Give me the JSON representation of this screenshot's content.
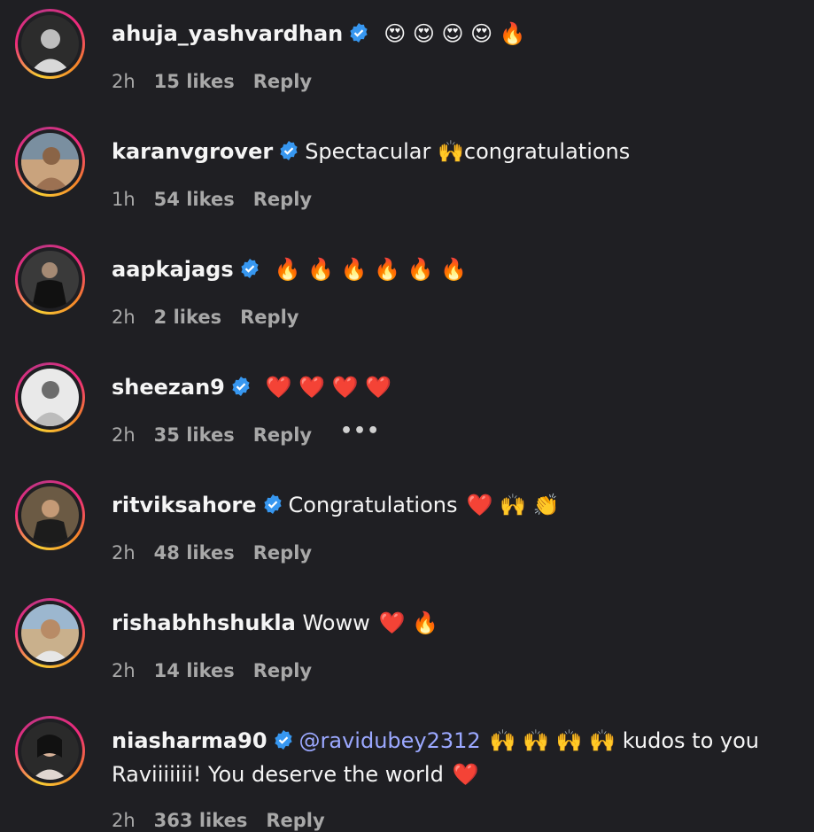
{
  "comments": [
    {
      "username": "ahuja_yashvardhan",
      "verified": true,
      "text": "",
      "emojis": "😍 😍 😍 😍 🔥",
      "time": "2h",
      "likes": "15 likes",
      "reply": "Reply"
    },
    {
      "username": "karanvgrover",
      "verified": true,
      "text": "Spectacular 🙌congratulations",
      "emojis": "",
      "time": "1h",
      "likes": "54 likes",
      "reply": "Reply"
    },
    {
      "username": "aapkajags",
      "verified": true,
      "text": "",
      "emojis": "🔥 🔥 🔥 🔥 🔥 🔥",
      "time": "2h",
      "likes": "2 likes",
      "reply": "Reply"
    },
    {
      "username": "sheezan9",
      "verified": true,
      "text": "",
      "emojis": "❤️ ❤️ ❤️ ❤️",
      "time": "2h",
      "likes": "35 likes",
      "reply": "Reply",
      "more": "•••"
    },
    {
      "username": "ritviksahore",
      "verified": true,
      "text": "Congratulations",
      "emojis": "❤️ 🙌 👏",
      "time": "2h",
      "likes": "48 likes",
      "reply": "Reply"
    },
    {
      "username": "rishabhhshukla",
      "verified": false,
      "text": "Woww",
      "emojis": "❤️ 🔥",
      "time": "2h",
      "likes": "14 likes",
      "reply": "Reply"
    },
    {
      "username": "niasharma90",
      "verified": true,
      "mention": "@ravidubey2312",
      "emojis": "🙌 🙌 🙌 🙌",
      "text": "kudos to you",
      "text_line2": "Raviiiiiii! You deserve the world",
      "emojis_line2": "❤️",
      "time": "2h",
      "likes": "363 likes",
      "reply": "Reply"
    }
  ],
  "colors": {
    "background": "#1f1f23",
    "text": "#f5f5f5",
    "meta": "#a8a8a8",
    "verified": "#3797f0",
    "mention": "#9ba8ff"
  }
}
